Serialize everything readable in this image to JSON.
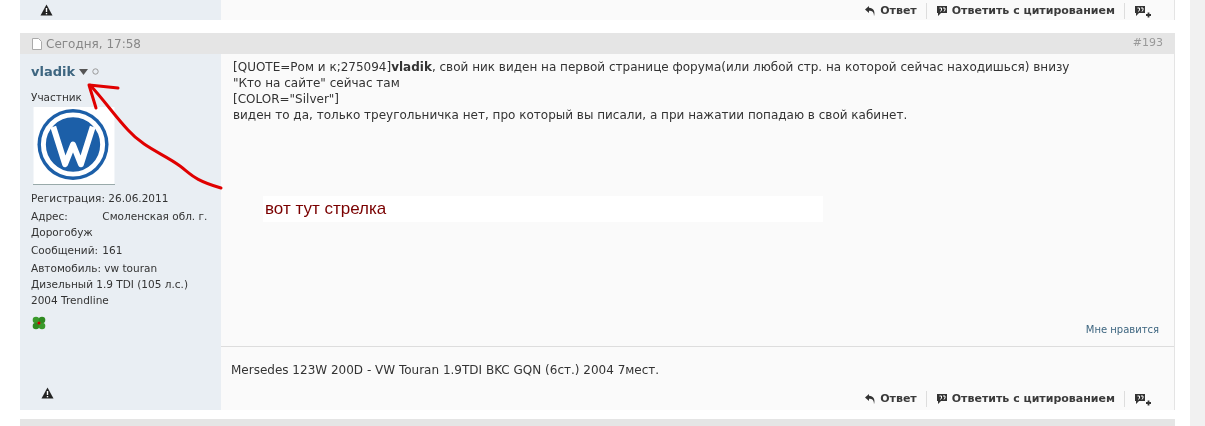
{
  "previous_post": {
    "buttons": [
      {
        "kind": "reply",
        "label": "Ответ"
      },
      {
        "kind": "quote",
        "label": "Ответить с цитированием"
      },
      {
        "kind": "multiquote"
      }
    ]
  },
  "post": {
    "date": "Сегодня, 17:58",
    "number": "#193",
    "user": {
      "name": "vladik",
      "online": false,
      "rank": "Участник",
      "fields": [
        {
          "label": "Регистрация:",
          "value": "26.06.2011"
        },
        {
          "label": "Адрес:",
          "value": "Смоленская обл. г. Дорогобуж"
        },
        {
          "label": "Сообщений:",
          "value": "161"
        },
        {
          "label": "Автомобиль:",
          "value": "vw touran Дизельный 1.9 TDI (105 л.с.) 2004 Trendline"
        }
      ]
    },
    "message": [
      "[QUOTE=Ром и к;275094]**vladik**, свой ник виден на первой странице форума(или любой стр. на которой сейчас находишься) внизу",
      "\"Кто на сайте\" сейчас там",
      "[COLOR=\"Silver\"]",
      "виден то да, только треугольничка нет, про который вы писали, а при нажатии попадаю в свой кабинет."
    ],
    "annotation": "вот тут стрелка",
    "like": "Мне нравится",
    "signature": "Mersedes 123W 200D - VW Touran 1.9TDI BKC GQN (6ст.) 2004 7мест.",
    "buttons": [
      {
        "kind": "reply",
        "label": "Ответ"
      },
      {
        "kind": "quote",
        "label": "Ответить с цитированием"
      },
      {
        "kind": "multiquote"
      }
    ]
  }
}
